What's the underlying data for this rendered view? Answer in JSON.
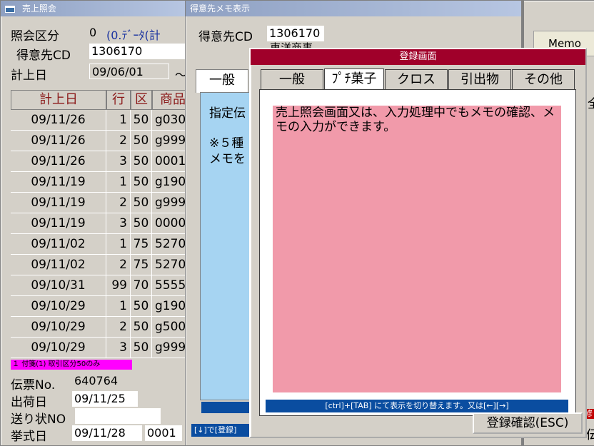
{
  "win1": {
    "title": "売上照会",
    "inquiry_label": "照会区分",
    "inquiry_value": "0",
    "inquiry_desc": "(0.ﾃﾞｰﾀ(計",
    "customer_label": "得意先CD",
    "customer_value": "1306170",
    "date_label": "計上日",
    "date_value": "09/06/01",
    "date_tilde": "〜",
    "table": {
      "headers": [
        "計上日",
        "行",
        "区",
        "商品"
      ],
      "rows": [
        [
          "09/11/26",
          "1",
          "50",
          "g030"
        ],
        [
          "09/11/26",
          "2",
          "50",
          "g999"
        ],
        [
          "09/11/26",
          "3",
          "50",
          "0001"
        ],
        [
          "09/11/19",
          "1",
          "50",
          "g190"
        ],
        [
          "09/11/19",
          "2",
          "50",
          "g999"
        ],
        [
          "09/11/19",
          "3",
          "50",
          "0000"
        ],
        [
          "09/11/02",
          "1",
          "75",
          "5270"
        ],
        [
          "09/11/02",
          "2",
          "75",
          "5270"
        ],
        [
          "09/10/31",
          "99",
          "70",
          "5555"
        ],
        [
          "09/10/29",
          "1",
          "50",
          "g190"
        ],
        [
          "09/10/29",
          "2",
          "50",
          "g500"
        ],
        [
          "09/10/29",
          "3",
          "50",
          "g999"
        ]
      ]
    },
    "note_badge": "１ 付箋(1) 取引区分50のみ",
    "slip_label": "伝票No.",
    "slip_value": "640764",
    "ship_label": "出荷日",
    "ship_value": "09/11/25",
    "invoice_label": "送り状NO",
    "invoice_value": "",
    "ceremony_label": "挙式日",
    "ceremony_value": "09/11/28",
    "ceremony_code": "0001"
  },
  "win2": {
    "title": "得意先メモ表示",
    "customer_label": "得意先CD",
    "customer_value": "1306170",
    "name_partial": "東洋商事",
    "tab_label": "一般",
    "content_line1": "指定伝",
    "content_line2": "※５種",
    "content_line3": "メモを",
    "status_partial": "[↓]で[登録]"
  },
  "win3": {
    "memo_label": "Memo",
    "right_partial_1": "全",
    "right_partial_2": "修",
    "right_partial_3": "伝"
  },
  "dialog": {
    "title": "登録画面",
    "tabs": [
      "一般",
      "ﾌﾟﾁ菓子",
      "クロス",
      "引出物",
      "その他"
    ],
    "memo_text": "売上照会画面又は、入力処理中でもメモの確認、メモの入力ができます。",
    "hint": "[ctrl]+[TAB] にて表示を切り替えます。又は[←][→]",
    "confirm_button": "登録確認(ESC)"
  },
  "colors": {
    "memo_bg": "#f19aaa",
    "dialog_title": "#a0002a",
    "status_blue": "#0a4da0",
    "badge_magenta": "#ff00ff",
    "panel_blue": "#a6d4f2",
    "header_text": "#8b1a1a"
  }
}
